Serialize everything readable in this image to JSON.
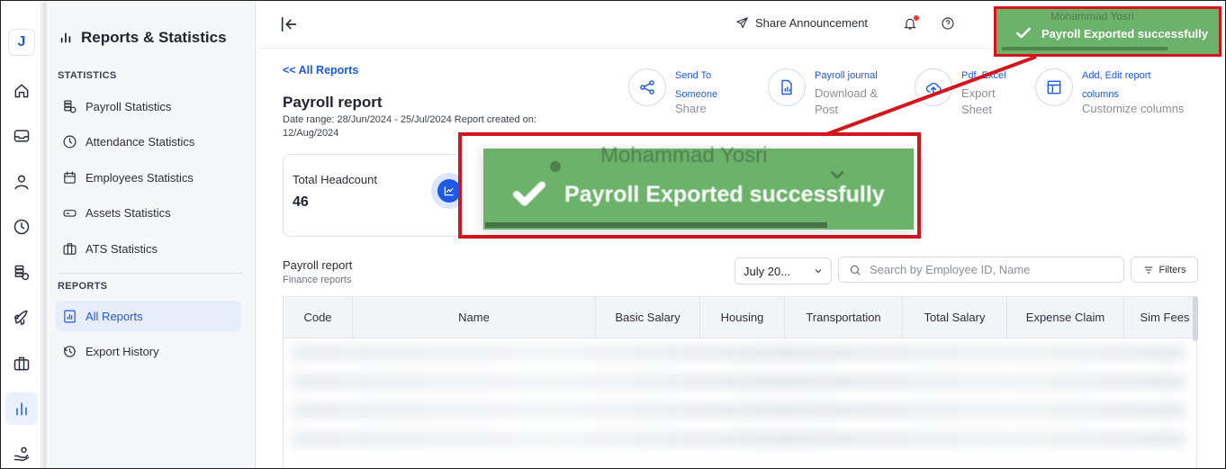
{
  "sidebar": {
    "title": "Reports & Statistics",
    "section_statistics": "STATISTICS",
    "statistics_items": [
      {
        "label": "Payroll Statistics",
        "icon": "coins-icon"
      },
      {
        "label": "Attendance Statistics",
        "icon": "clock-icon"
      },
      {
        "label": "Employees Statistics",
        "icon": "calendar-icon"
      },
      {
        "label": "Assets Statistics",
        "icon": "drive-icon"
      },
      {
        "label": "ATS Statistics",
        "icon": "briefcase-icon"
      }
    ],
    "section_reports": "REPORTS",
    "report_items": [
      {
        "label": "All Reports",
        "icon": "report-chart-icon",
        "active": true
      },
      {
        "label": "Export History",
        "icon": "history-icon"
      }
    ]
  },
  "rail": {
    "logo": "J",
    "icons": [
      "home-icon",
      "inbox-icon",
      "user-icon",
      "clock-icon",
      "coins-icon",
      "rocket-icon",
      "briefcase-icon",
      "bar-chart-icon",
      "hand-coin-icon"
    ]
  },
  "topbar": {
    "share_announcement": "Share Announcement",
    "user_name": "Mohammad Yosri"
  },
  "page": {
    "back_link": "<< All Reports",
    "title": "Payroll report",
    "meta": "Date range: 28/Jun/2024 - 25/Jul/2024 Report created on: 12/Aug/2024"
  },
  "actions": [
    {
      "line1": "Send To",
      "line2": "Someone",
      "line3": "Share"
    },
    {
      "line1": "Payroll journal",
      "line2": "Download &",
      "line3": "Post"
    },
    {
      "line1": "Pdf, Excel",
      "line2": "Export",
      "line3": "Sheet"
    },
    {
      "line1": "Add, Edit report",
      "line2": "columns",
      "line3": "Customize columns"
    }
  ],
  "summary": {
    "label": "Total Headcount",
    "value": "46"
  },
  "table": {
    "title": "Payroll report",
    "subtitle": "Finance reports",
    "month_select": "July 20...",
    "search_placeholder": "Search by Employee ID, Name",
    "filters_label": "Filters",
    "columns": [
      "Code",
      "Name",
      "Basic Salary",
      "Housing",
      "Transportation",
      "Total Salary",
      "Expense Claim",
      "Sim Fees"
    ]
  },
  "toast": {
    "message": "Payroll Exported successfully",
    "behind_text": "Mohammad Yosri"
  },
  "colors": {
    "accent": "#1d5ae8",
    "toast_green": "#6cb26b",
    "highlight_red": "#d4161c"
  }
}
